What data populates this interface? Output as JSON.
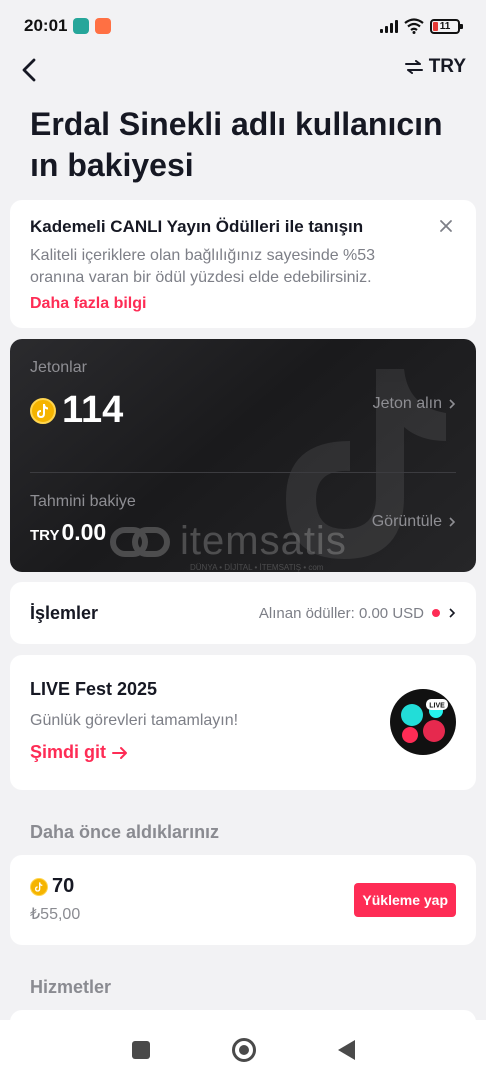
{
  "status_bar": {
    "time": "20:01",
    "battery": "11"
  },
  "nav": {
    "currency": "TRY"
  },
  "page_title": "Erdal Sinekli adlı kullanıcın ın bakiyesi",
  "promo": {
    "title": "Kademeli CANLI Yayın Ödülleri ile tanışın",
    "text": "Kaliteli içeriklere olan bağlılığınız sayesinde %53 oranına varan bir ödül yüzdesi elde edebilirsiniz.",
    "link": "Daha fazla bilgi"
  },
  "balance": {
    "coins_label": "Jetonlar",
    "coins_value": "114",
    "get_coins": "Jeton alın",
    "estimated_label": "Tahmini bakiye",
    "estimated_currency": "TRY",
    "estimated_value": "0.00",
    "view": "Görüntüle"
  },
  "watermark": {
    "text": "itemsatis",
    "sub": "DÜNYA • DİJİTAL • İTEMSATIŞ • com"
  },
  "transactions": {
    "title": "İşlemler",
    "rewards": "Alınan ödüller: 0.00 USD"
  },
  "fest": {
    "title": "LIVE Fest 2025",
    "subtitle": "Günlük görevleri tamamlayın!",
    "cta": "Şimdi git",
    "badge": "LIVE"
  },
  "previous": {
    "label": "Daha önce aldıklarınız",
    "coins": "70",
    "price": "₺55,00",
    "button": "Yükleme yap"
  },
  "services_label": "Hizmetler",
  "colors": {
    "accent": "#fe2c55",
    "coin": "#f5b400",
    "card_dark": "#1f1f21"
  }
}
